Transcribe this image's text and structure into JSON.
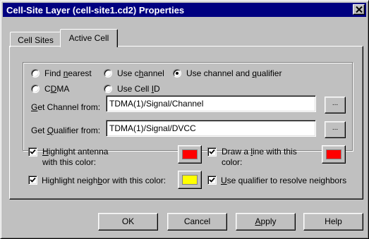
{
  "window": {
    "title": "Cell-Site Layer (cell-site1.cd2) Properties"
  },
  "tabs": [
    {
      "label": "Cell Sites",
      "active": false
    },
    {
      "label": "Active Cell",
      "active": true
    }
  ],
  "mode_options": [
    {
      "pre": "Find ",
      "key": "n",
      "post": "earest",
      "selected": false
    },
    {
      "pre": "Use c",
      "key": "h",
      "post": "annel",
      "selected": false
    },
    {
      "pre": "Use channel and ",
      "key": "q",
      "post": "ualifier",
      "selected": true
    },
    {
      "pre": "C",
      "key": "D",
      "post": "MA",
      "selected": false
    },
    {
      "pre": "Use Cell ",
      "key": "I",
      "post": "D",
      "selected": false
    }
  ],
  "channel_field": {
    "label_key": "G",
    "label_rest": "et Channel from:",
    "value": "TDMA(1)/Signal/Channel",
    "browse_label": "..."
  },
  "qualifier_field": {
    "label_pre": "Get ",
    "label_key": "Q",
    "label_rest": "ualifier from:",
    "value": "TDMA(1)/Signal/DVCC",
    "browse_label": "..."
  },
  "options": {
    "highlight_antenna": {
      "checked": true,
      "line1_key": "H",
      "line1_rest": "ighlight antenna",
      "line2": "with this color:",
      "color": "#ff0000"
    },
    "draw_line": {
      "checked": true,
      "line1_pre": "Draw a ",
      "line1_key": "l",
      "line1_rest": "ine with this",
      "line2": "color:",
      "color": "#ff0000"
    },
    "highlight_neighbor": {
      "checked": true,
      "label_pre": "Highlight neigh",
      "label_key": "b",
      "label_rest": "or with this color:",
      "color": "#ffff00"
    },
    "use_qualifier": {
      "checked": true,
      "label_key": "U",
      "label_rest": "se qualifier to resolve neighbors"
    }
  },
  "buttons": {
    "ok": "OK",
    "cancel": "Cancel",
    "apply_key": "A",
    "apply_rest": "pply",
    "help": "Help"
  }
}
